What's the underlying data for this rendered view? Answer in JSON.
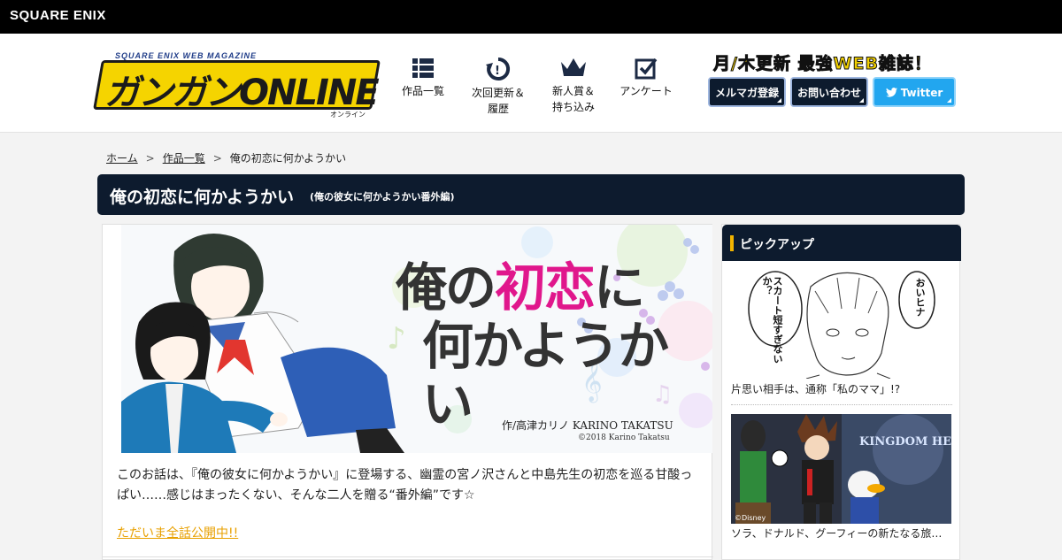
{
  "corp": {
    "logo_text": "SQUARE ENIX"
  },
  "header": {
    "logo_sub": "SQUARE ENIX WEB MAGAZINE",
    "logo_main": "ガンガンONLINE",
    "logo_tag": "オンライン",
    "nav": [
      {
        "line1": "作品一覧",
        "line2": "",
        "icon": "list-icon"
      },
      {
        "line1": "次回更新＆",
        "line2": "履歴",
        "icon": "update-history-icon"
      },
      {
        "line1": "新人賞＆",
        "line2": "持ち込み",
        "icon": "crown-icon"
      },
      {
        "line1": "アンケート",
        "line2": "",
        "icon": "checkbox-icon"
      }
    ],
    "catchphrase": "月/木更新 最強WEB雑誌！",
    "buttons": {
      "mail": "メルマガ登録",
      "contact": "お問い合わせ",
      "twitter": "Twitter"
    }
  },
  "breadcrumb": {
    "home": "ホーム",
    "list": "作品一覧",
    "current": "俺の初恋に何かようかい",
    "sep": ">"
  },
  "title": {
    "main": "俺の初恋に何かようかい",
    "sub": "(俺の彼女に何かようかい番外編)"
  },
  "hero": {
    "title_a": "俺の",
    "title_b": "初恋",
    "title_c": "に",
    "title_d": "何かようかい",
    "author": "作/高津カリノ KARINO TAKATSU",
    "copyright": "©2018 Karino Takatsu"
  },
  "description": "このお話は、『俺の彼女に何かようかい』に登場する、幽霊の宮ノ沢さんと中島先生の初恋を巡る甘酸っぱい……感じはまったくない、そんな二人を贈る“番外編”です☆",
  "open_link": "ただいま全話公開中!!",
  "sidebar": {
    "heading": "ピックアップ",
    "items": [
      {
        "caption": "片思い相手は、通称「私のママ」!?",
        "balloon1": "スカート短すぎないか？",
        "balloon2": "おいヒナ"
      },
      {
        "caption": "ソラ、ドナルド、グーフィーの新たなる旅…",
        "logo": "KINGDOM HEARTS III",
        "copy": "©Disney"
      }
    ]
  },
  "colors": {
    "navy": "#0d1b2e",
    "twitter": "#22a6ef",
    "accent_yellow": "#f2d000",
    "pink": "#e0178c",
    "link_orange": "#e8a000"
  }
}
